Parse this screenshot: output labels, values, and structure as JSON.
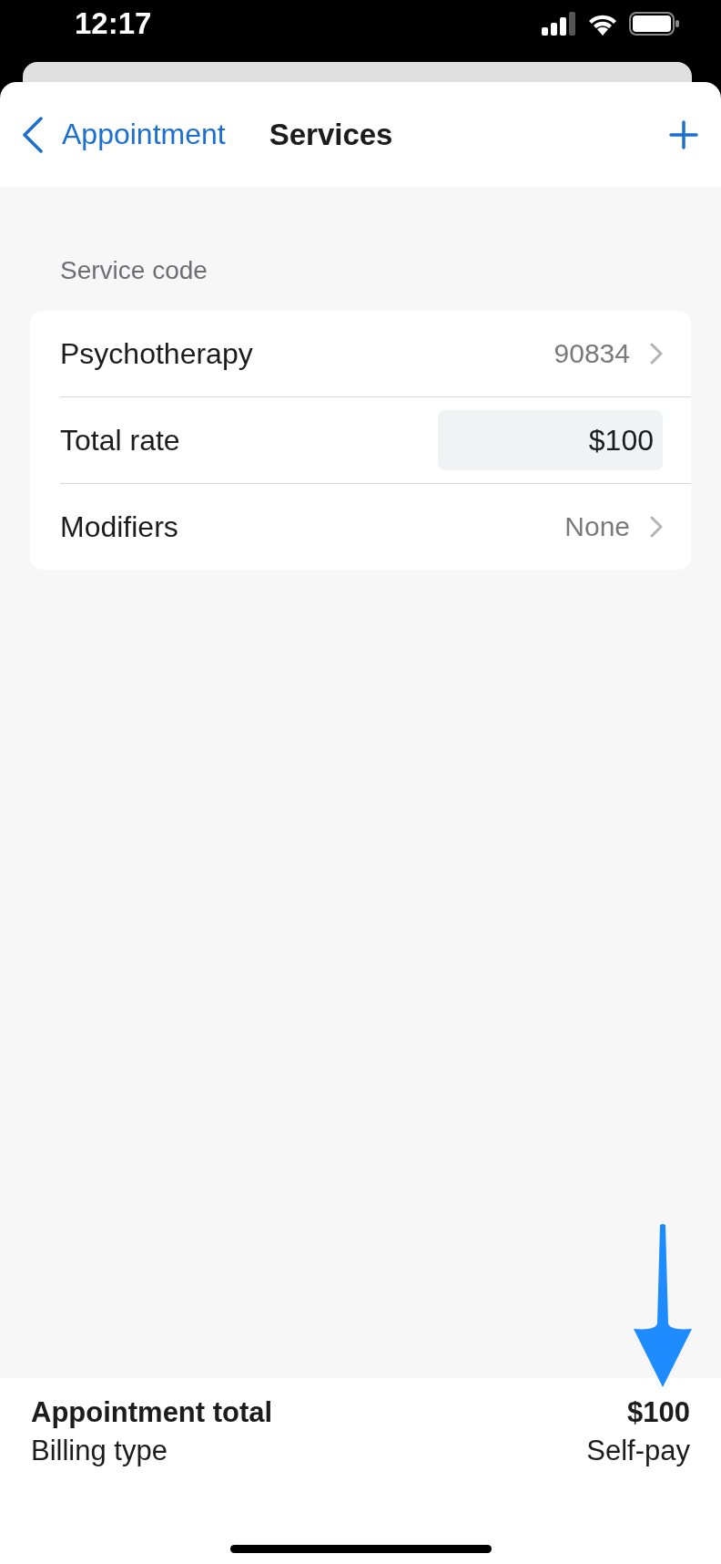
{
  "status_bar": {
    "time": "12:17"
  },
  "nav_bar": {
    "back_label": "Appointment",
    "title": "Services"
  },
  "section": {
    "header": "Service code",
    "rows": [
      {
        "kind": "link",
        "label": "Psychotherapy",
        "value": "90834"
      },
      {
        "kind": "field",
        "label": "Total rate",
        "value": "$100"
      },
      {
        "kind": "link",
        "label": "Modifiers",
        "value": "None"
      }
    ]
  },
  "footer": {
    "total_label": "Appointment total",
    "total_value": "$100",
    "billing_label": "Billing type",
    "billing_value": "Self-pay"
  }
}
